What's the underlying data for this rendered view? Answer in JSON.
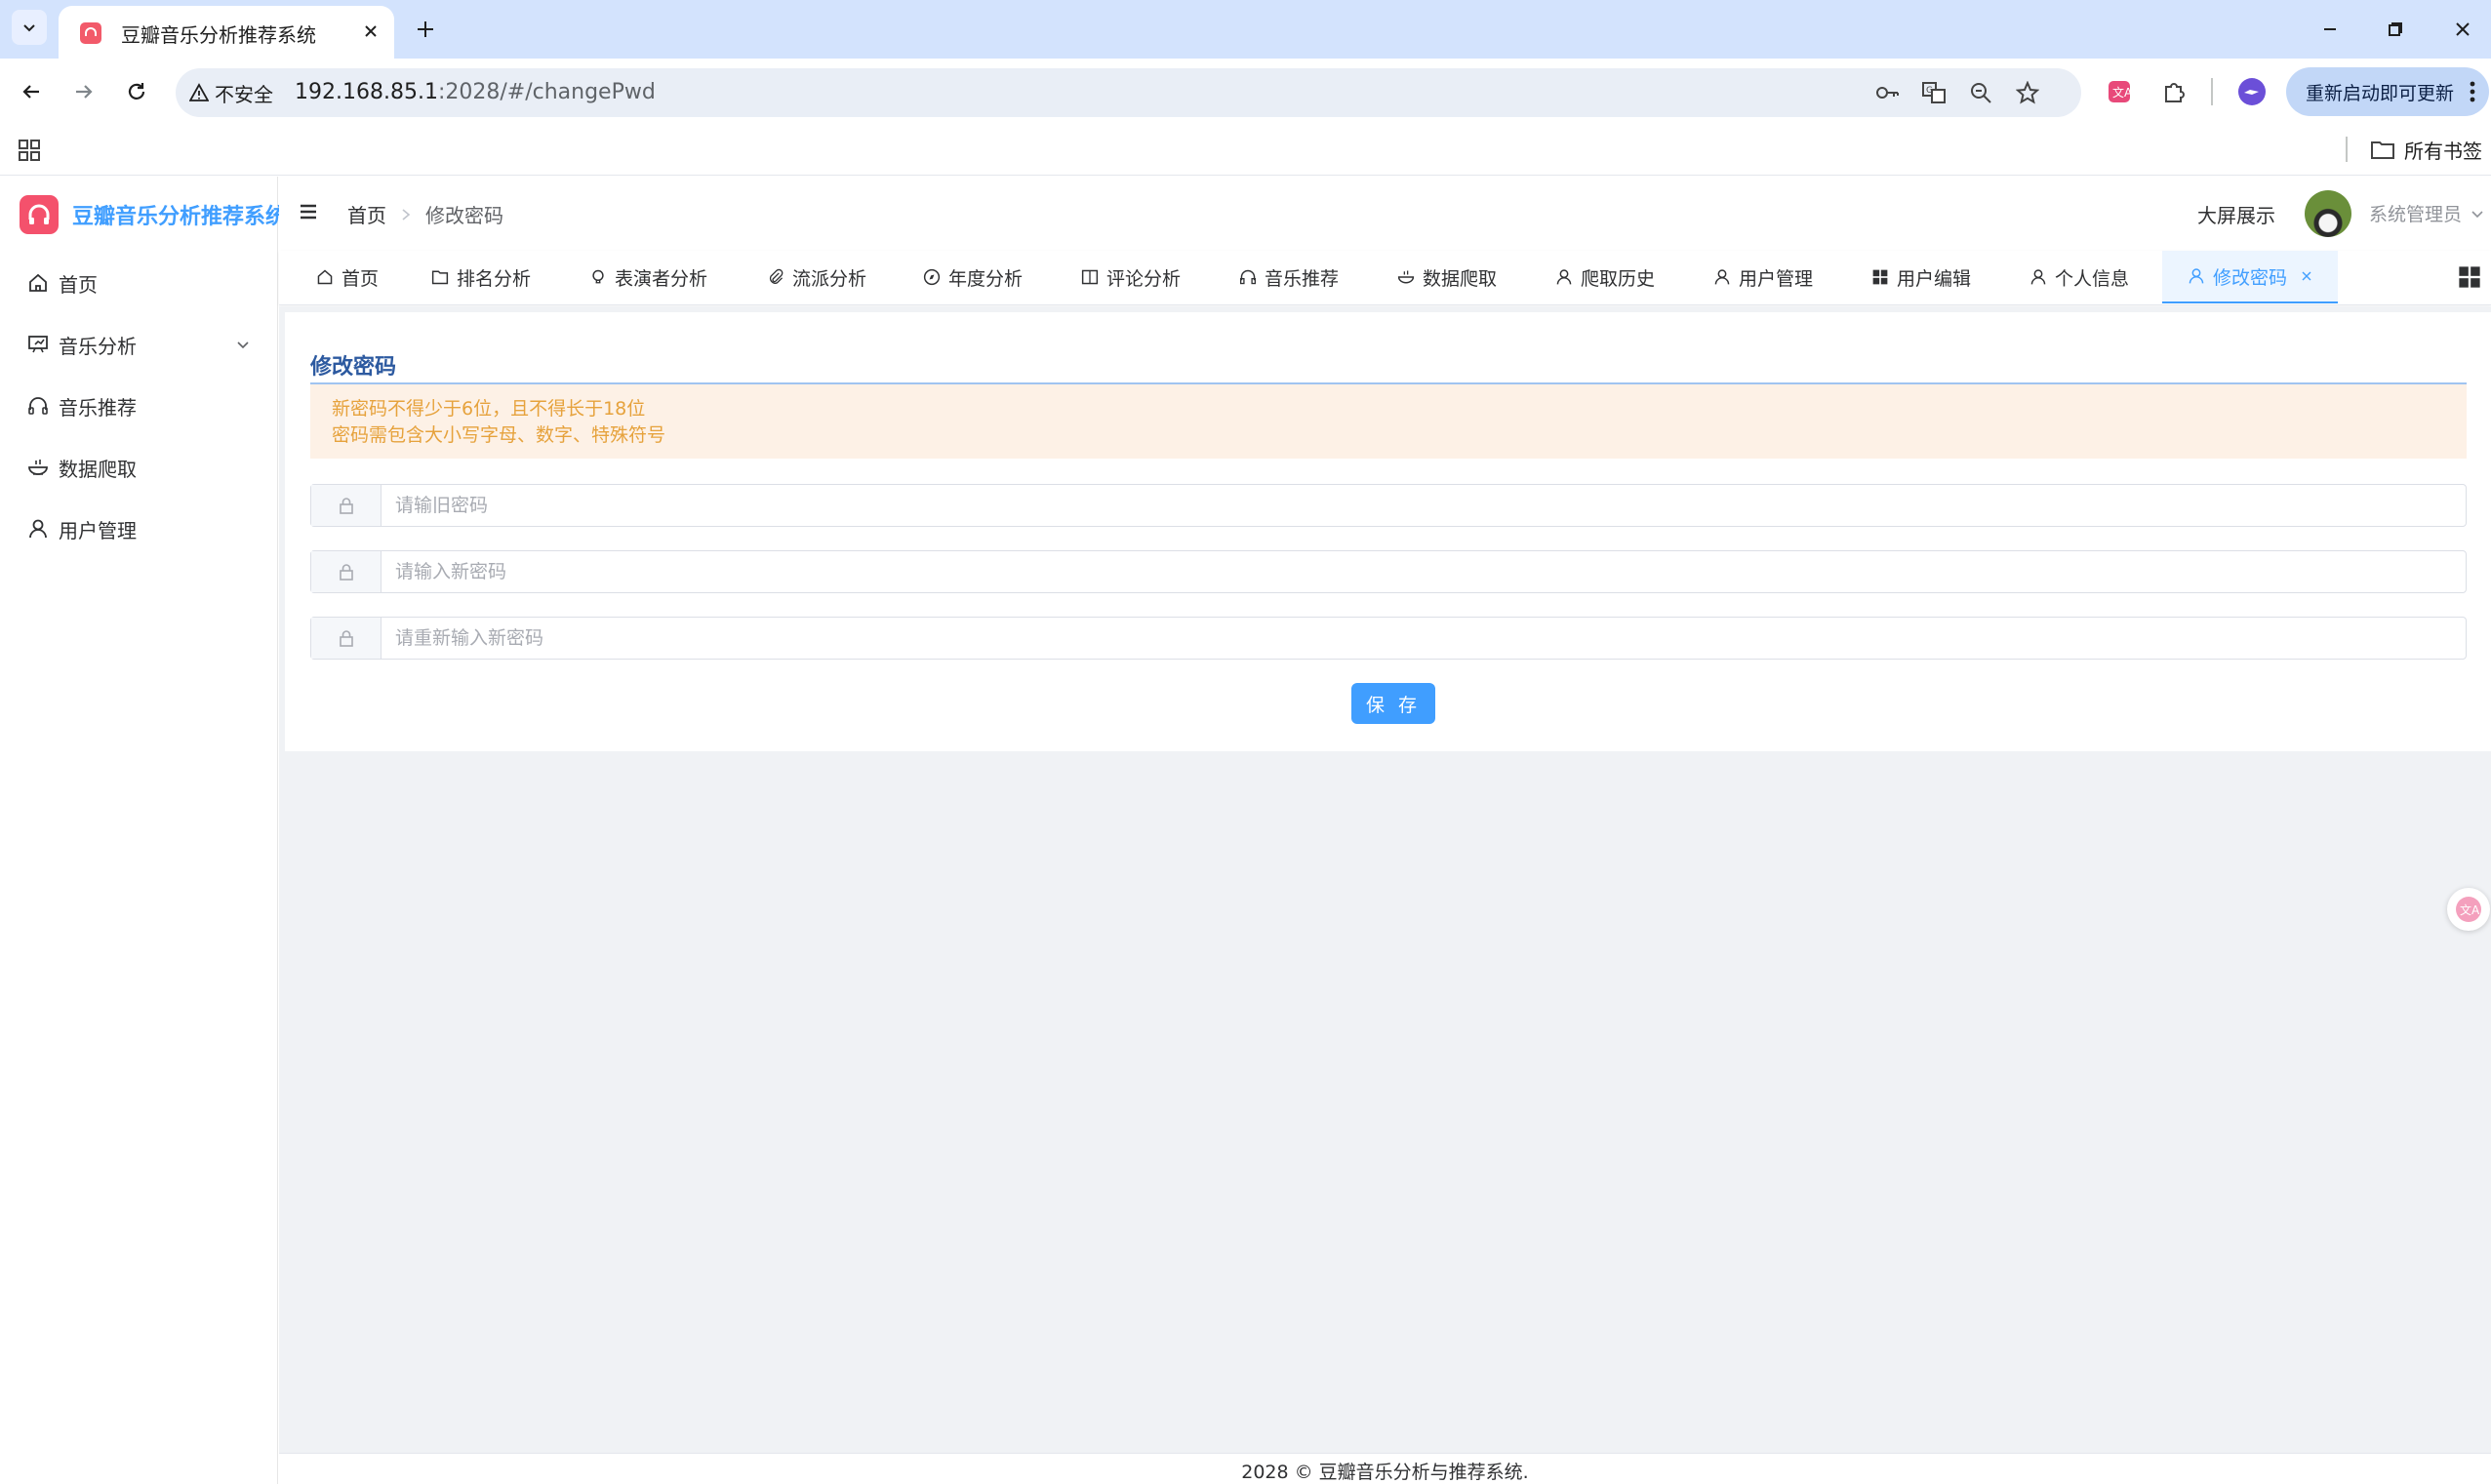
{
  "browser": {
    "tab_title": "豆瓣音乐分析推荐系统",
    "insecure_label": "不安全",
    "url_host": "192.168.85.1",
    "url_rest": ":2028/#/changePwd",
    "update_button": "重新启动即可更新",
    "all_bookmarks": "所有书签"
  },
  "brand": {
    "name": "豆瓣音乐分析推荐系统",
    "color": "#409eff",
    "logo_color": "#f4516c"
  },
  "sidebar": {
    "items": [
      {
        "label": "首页",
        "icon": "home-icon"
      },
      {
        "label": "音乐分析",
        "icon": "presentation-icon",
        "has_submenu": true
      },
      {
        "label": "音乐推荐",
        "icon": "headphones-icon"
      },
      {
        "label": "数据爬取",
        "icon": "bowl-icon"
      },
      {
        "label": "用户管理",
        "icon": "user-icon"
      }
    ]
  },
  "header": {
    "breadcrumb_home": "首页",
    "breadcrumb_current": "修改密码",
    "screen_link": "大屏展示",
    "user_name": "系统管理员"
  },
  "tags": [
    {
      "label": "首页",
      "icon": "home-icon"
    },
    {
      "label": "排名分析",
      "icon": "folder-icon"
    },
    {
      "label": "表演者分析",
      "icon": "bulb-icon"
    },
    {
      "label": "流派分析",
      "icon": "paperclip-icon"
    },
    {
      "label": "年度分析",
      "icon": "compass-icon"
    },
    {
      "label": "评论分析",
      "icon": "book-icon"
    },
    {
      "label": "音乐推荐",
      "icon": "headphones-icon"
    },
    {
      "label": "数据爬取",
      "icon": "bowl-icon"
    },
    {
      "label": "爬取历史",
      "icon": "user-icon"
    },
    {
      "label": "用户管理",
      "icon": "user-icon"
    },
    {
      "label": "用户编辑",
      "icon": "grid-icon"
    },
    {
      "label": "个人信息",
      "icon": "user-icon"
    },
    {
      "label": "修改密码",
      "icon": "user-icon",
      "active": true
    }
  ],
  "form": {
    "title": "修改密码",
    "tips": [
      "新密码不得少于6位，且不得长于18位",
      "密码需包含大小写字母、数字、特殊符号"
    ],
    "old_password_placeholder": "请输旧密码",
    "new_password_placeholder": "请输入新密码",
    "confirm_password_placeholder": "请重新输入新密码",
    "save_label": "保 存"
  },
  "footer": {
    "text": "2028 © 豆瓣音乐分析与推荐系统."
  },
  "colors": {
    "primary": "#409eff",
    "warning_text": "#e6a23c",
    "warning_bg": "#fdf1e6",
    "title_blue": "#2d5aa0"
  }
}
